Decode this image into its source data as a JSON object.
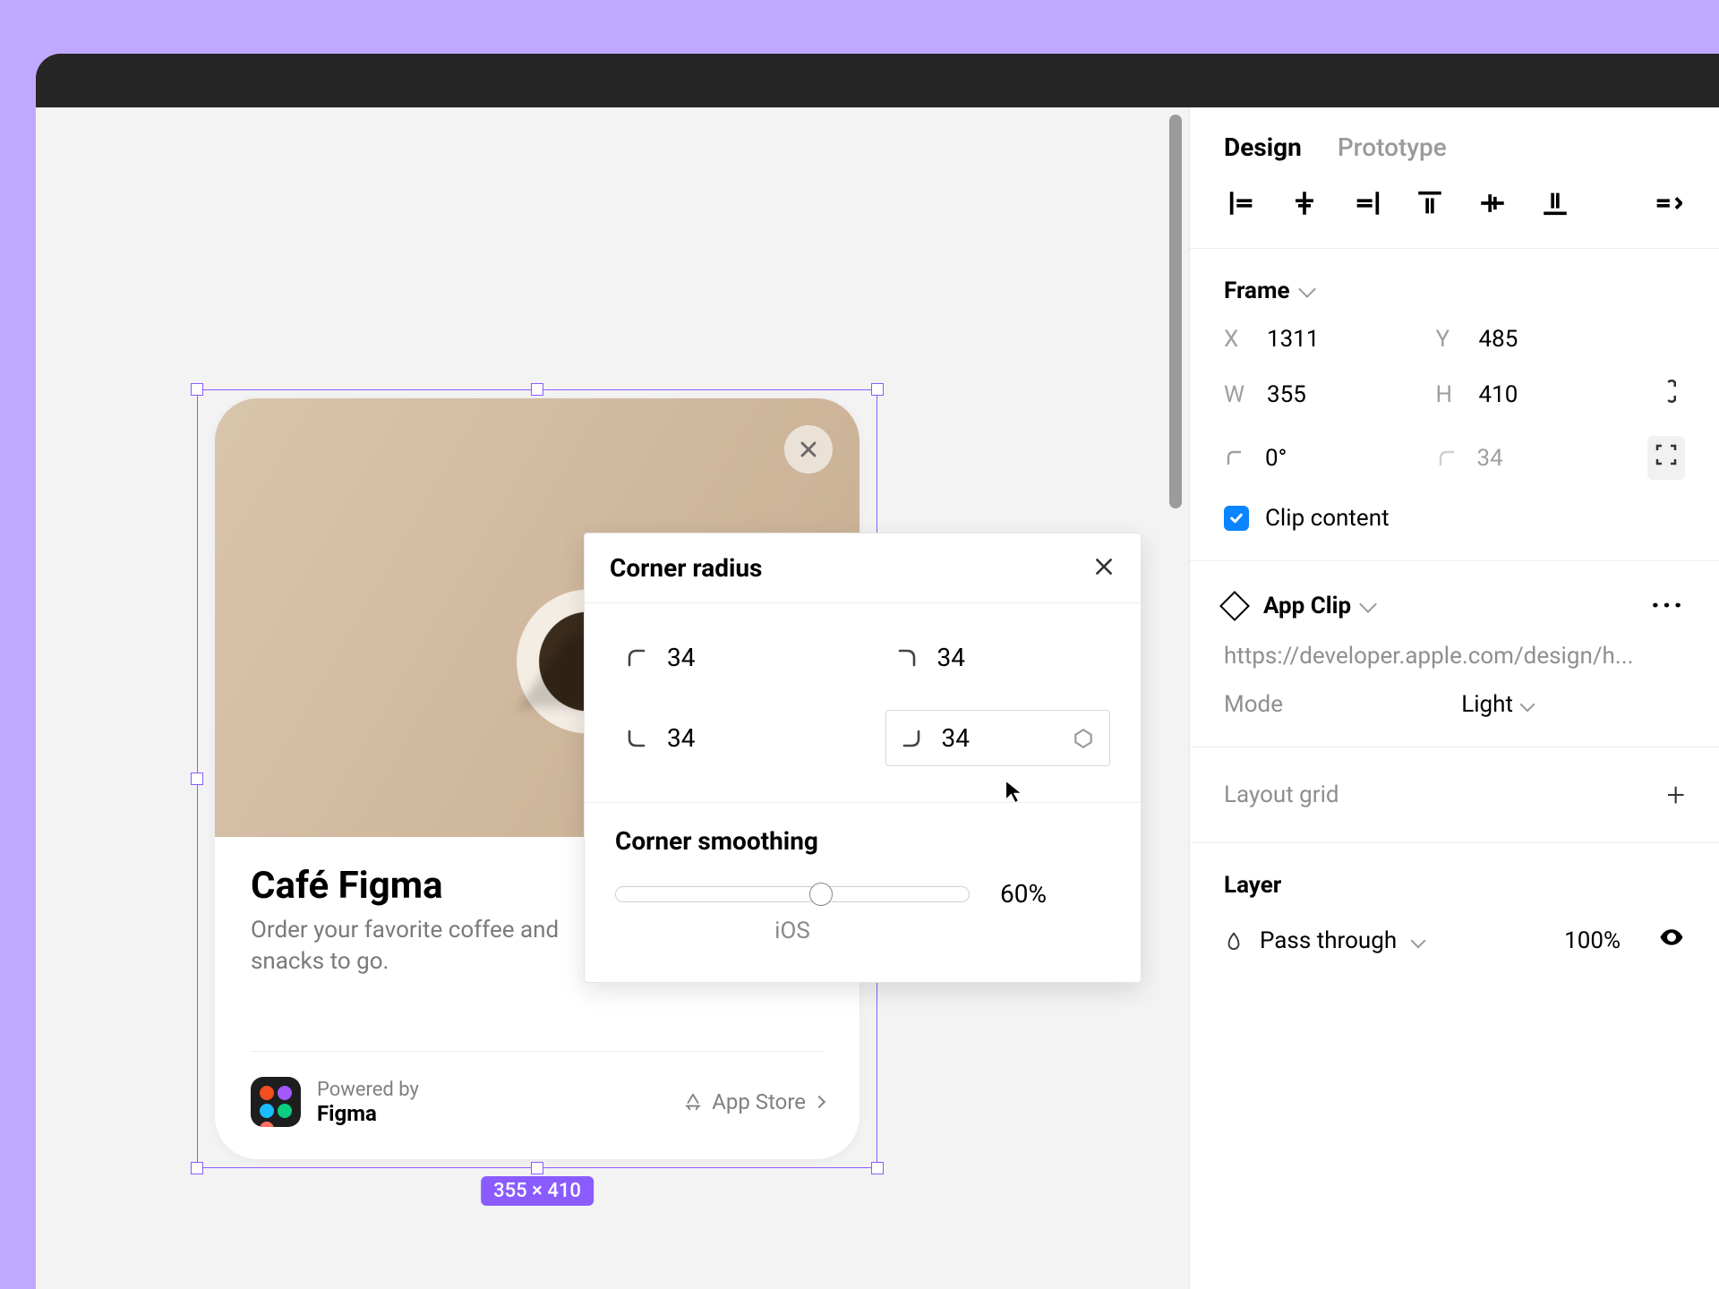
{
  "inspector": {
    "tabs": {
      "design": "Design",
      "prototype": "Prototype"
    },
    "frame": {
      "title": "Frame",
      "x_label": "X",
      "x": "1311",
      "y_label": "Y",
      "y": "485",
      "w_label": "W",
      "w": "355",
      "h_label": "H",
      "h": "410",
      "rot": "0°",
      "radius": "34",
      "clip_label": "Clip content"
    },
    "appclip": {
      "title": "App Clip",
      "link": "https://developer.apple.com/design/h...",
      "mode_label": "Mode",
      "mode_value": "Light"
    },
    "layout_grid_label": "Layout grid",
    "layer": {
      "title": "Layer",
      "blend": "Pass through",
      "opacity": "100%"
    }
  },
  "popup": {
    "title": "Corner radius",
    "tl": "34",
    "tr": "34",
    "bl": "34",
    "br": "34",
    "smooth_label": "Corner smoothing",
    "smooth_value": "60%",
    "smooth_tag": "iOS"
  },
  "card": {
    "title": "Café Figma",
    "subtitle": "Order your favorite coffee and snacks to go.",
    "powered": "Powered by",
    "brand": "Figma",
    "store": "App Store"
  },
  "selection_dims": "355 × 410"
}
